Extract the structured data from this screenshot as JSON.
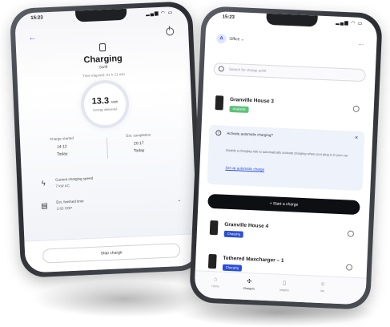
{
  "left_phone": {
    "status_time": "15:23",
    "status_icons": "▂▄▆ ◠ ▭",
    "title": "Charging",
    "subtitle": "Swift",
    "meta": "Time elapsed: 01 h 21 min",
    "gauge_value": "13.3",
    "gauge_unit": "kWh",
    "gauge_label": "Energy delivered",
    "start": {
      "label": "Charge started",
      "time": "14:12",
      "day": "Today"
    },
    "complete": {
      "label": "Est. completion",
      "time": "20:17",
      "day": "Today"
    },
    "speed": {
      "title": "Current charging speed",
      "value": "7 kW AC"
    },
    "energy": {
      "title": "Est. finished time",
      "value": "3.83 GBP"
    },
    "stop_label": "Stop charge"
  },
  "right_phone": {
    "status_time": "15:23",
    "status_icons": "▂▄▆ ◠ ▭",
    "account_initial": "A",
    "account_name": "Office",
    "search_placeholder": "Search for charge point",
    "auto_card": {
      "heading": "Activate automatic charging?",
      "body": "Enable a charging rule to automatically activate charging when your plug is in your car",
      "link": "Set up automatic charge"
    },
    "start_label": "Start a charge",
    "chargers": [
      {
        "name": "Granville House 3",
        "badge": "Available",
        "badge_color": "#5cc27a"
      },
      {
        "name": "Granville House 4",
        "badge": "Charging",
        "badge_color": "#2b4fd6"
      },
      {
        "name": "Tethered Maxcharger – 1",
        "badge": "Charging",
        "badge_color": "#2b4fd6"
      }
    ],
    "tabs": [
      {
        "label": "Home",
        "icon": "⌂"
      },
      {
        "label": "Chargers",
        "icon": "✣"
      },
      {
        "label": "Insights",
        "icon": "▯"
      },
      {
        "label": "Me",
        "icon": "☺"
      }
    ]
  }
}
